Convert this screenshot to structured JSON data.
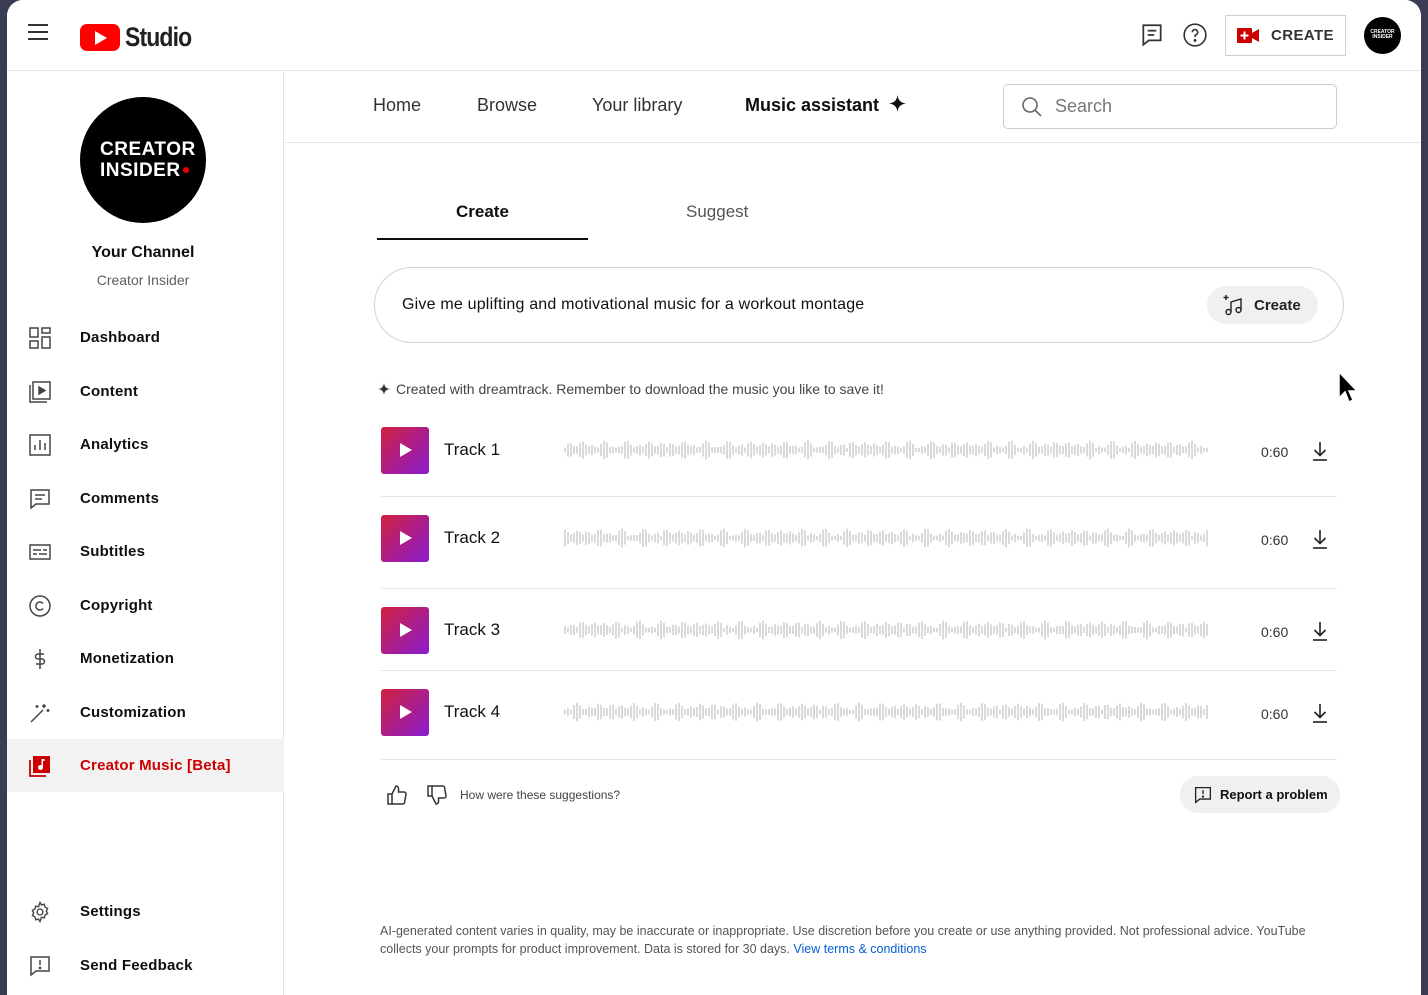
{
  "app": {
    "logo_text": "Studio"
  },
  "topbar": {
    "create_label": "CREATE",
    "avatar_text": "CREATOR INSIDER"
  },
  "channel": {
    "avatar_line1": "CREATOR",
    "avatar_line2": "INSIDER",
    "your_channel": "Your Channel",
    "name": "Creator Insider"
  },
  "sidebar": {
    "items": [
      {
        "label": "Dashboard",
        "icon": "dashboard-icon"
      },
      {
        "label": "Content",
        "icon": "content-icon"
      },
      {
        "label": "Analytics",
        "icon": "analytics-icon"
      },
      {
        "label": "Comments",
        "icon": "comments-icon"
      },
      {
        "label": "Subtitles",
        "icon": "subtitles-icon"
      },
      {
        "label": "Copyright",
        "icon": "copyright-icon"
      },
      {
        "label": "Monetization",
        "icon": "dollar-icon"
      },
      {
        "label": "Customization",
        "icon": "magic-wand-icon"
      },
      {
        "label": "Creator Music [Beta]",
        "icon": "music-note-icon",
        "active": true
      }
    ],
    "bottom": [
      {
        "label": "Settings",
        "icon": "gear-icon"
      },
      {
        "label": "Send Feedback",
        "icon": "feedback-icon"
      }
    ]
  },
  "mainnav": {
    "tabs": [
      "Home",
      "Browse",
      "Your library",
      "Music assistant"
    ],
    "active_index": 3,
    "search_placeholder": "Search"
  },
  "subtabs": {
    "create": "Create",
    "suggest": "Suggest",
    "active": "Create"
  },
  "prompt": {
    "text": "Give me uplifting and motivational music for a workout montage",
    "button_label": "Create"
  },
  "notice": "Created with dreamtrack. Remember to download the music you like to save it!",
  "tracks": [
    {
      "name": "Track 1",
      "duration": "0:60"
    },
    {
      "name": "Track 2",
      "duration": "0:60"
    },
    {
      "name": "Track 3",
      "duration": "0:60"
    },
    {
      "name": "Track 4",
      "duration": "0:60"
    }
  ],
  "feedback": {
    "question": "How were these suggestions?",
    "report_label": "Report a problem"
  },
  "disclaimer": {
    "text": "AI-generated content varies in quality, may be inaccurate or inappropriate. Use discretion before you create or use anything provided. Not professional advice. YouTube collects your prompts for product improvement. Data is stored for 30 days.",
    "link_text": "View terms & conditions"
  },
  "colors": {
    "brand_red": "#ff0000",
    "active_red": "#cc0000",
    "link_blue": "#065fd4"
  }
}
